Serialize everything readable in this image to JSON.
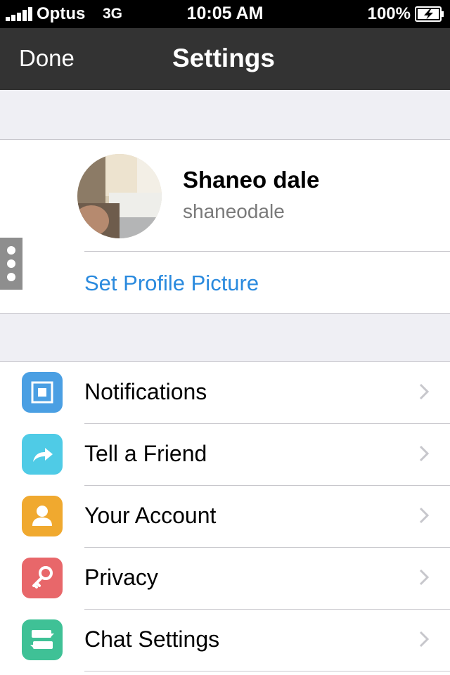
{
  "status_bar": {
    "carrier": "Optus",
    "network": "3G",
    "time": "10:05 AM",
    "battery": "100%"
  },
  "nav": {
    "done_label": "Done",
    "title": "Settings"
  },
  "profile": {
    "name": "Shaneo dale",
    "username": "shaneodale",
    "set_picture_label": "Set Profile Picture"
  },
  "settings": {
    "items": [
      {
        "label": "Notifications",
        "icon": "notifications-icon",
        "color": "#4a9fe3"
      },
      {
        "label": "Tell a Friend",
        "icon": "share-icon",
        "color": "#4fcbe6"
      },
      {
        "label": "Your Account",
        "icon": "account-icon",
        "color": "#f0a92f"
      },
      {
        "label": "Privacy",
        "icon": "key-icon",
        "color": "#e8676a"
      },
      {
        "label": "Chat Settings",
        "icon": "chat-settings-icon",
        "color": "#3fc196"
      }
    ]
  },
  "colors": {
    "nav_background": "#333333",
    "link_blue": "#2a8ade",
    "group_background": "#efeff4"
  }
}
